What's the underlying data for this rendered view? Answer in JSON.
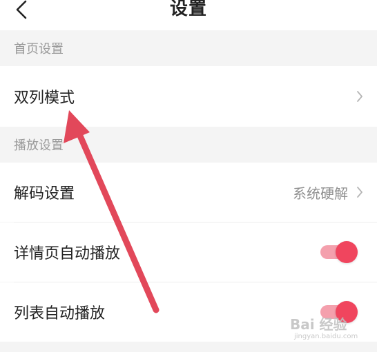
{
  "header": {
    "title": "设置",
    "back_icon": "chevron-left-icon"
  },
  "sections": [
    {
      "title": "首页设置",
      "items": [
        {
          "label": "双列模式"
        }
      ]
    },
    {
      "title": "播放设置",
      "items": [
        {
          "label": "解码设置",
          "value": "系统硬解"
        },
        {
          "label": "详情页自动播放",
          "toggle": true
        },
        {
          "label": "列表自动播放",
          "toggle": true
        }
      ]
    }
  ],
  "colors": {
    "accent": "#f0455e",
    "toggle_track": "#f4a0ad",
    "annotation_arrow": "#e2485a"
  },
  "watermark": {
    "main": "Bai 经验",
    "sub": "jingyan.baidu.com"
  }
}
